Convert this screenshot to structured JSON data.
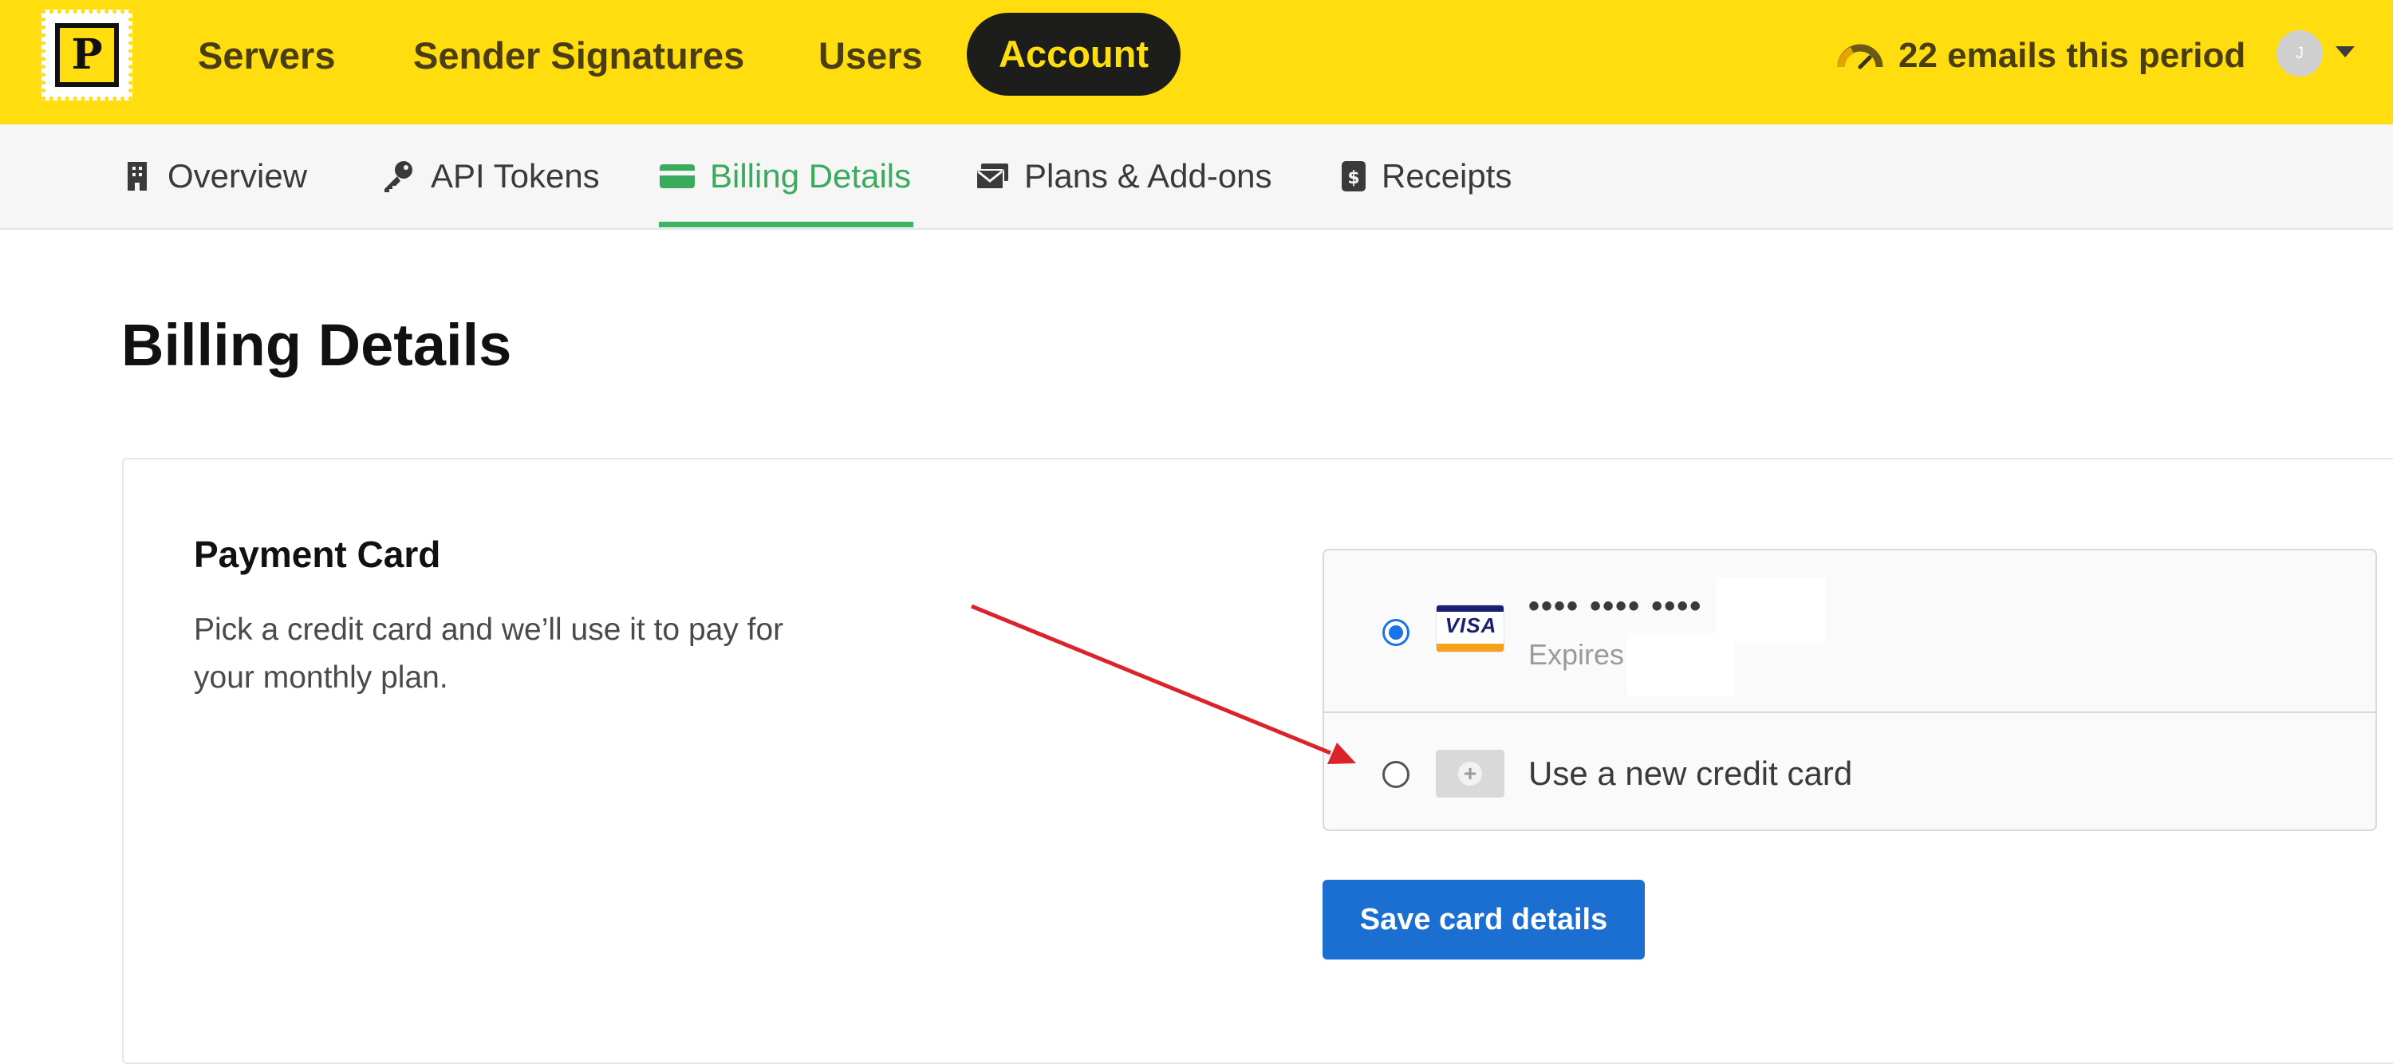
{
  "app": {
    "logo_letter": "P"
  },
  "topnav": {
    "items": [
      {
        "label": "Servers"
      },
      {
        "label": "Sender Signatures"
      },
      {
        "label": "Users"
      },
      {
        "label": "Account",
        "active": true
      }
    ],
    "usage_text": "22 emails this period",
    "usage_icon": "gauge-icon",
    "avatar_initial": "J",
    "colors": {
      "bar": "#ffdd0e",
      "active_pill": "#1d1d1b",
      "text": "#4a3d12"
    }
  },
  "subnav": {
    "tabs": [
      {
        "label": "Overview",
        "icon": "building-icon"
      },
      {
        "label": "API Tokens",
        "icon": "key-icon"
      },
      {
        "label": "Billing Details",
        "icon": "credit-card-icon",
        "active": true
      },
      {
        "label": "Plans & Add-ons",
        "icon": "envelopes-icon"
      },
      {
        "label": "Receipts",
        "icon": "receipt-icon"
      }
    ],
    "active_color": "#3aaa5c"
  },
  "page": {
    "title": "Billing Details"
  },
  "payment": {
    "heading": "Payment Card",
    "description": "Pick a credit card and we’ll use it to pay for your monthly plan.",
    "cards": [
      {
        "brand": "VISA",
        "masked_number": "•••• •••• ••••",
        "expires_label": "Expires",
        "selected": true
      }
    ],
    "new_card_label": "Use a new credit card",
    "save_button": "Save card details",
    "button_color": "#1a6fd0"
  },
  "annotation": {
    "arrow_color": "#d9242c"
  }
}
